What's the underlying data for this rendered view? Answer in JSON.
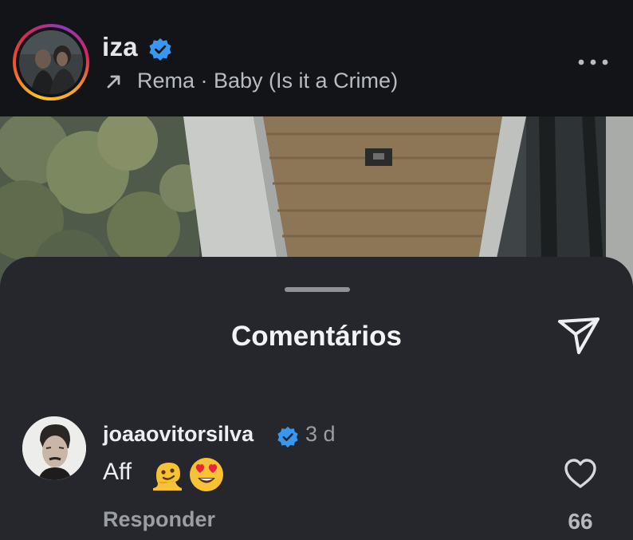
{
  "story": {
    "username": "iza",
    "verified": true,
    "music": "Rema · Baby (Is it a Crime)",
    "icons": {
      "music": "arrow-up-right-icon",
      "more": "more-dots-icon"
    }
  },
  "comments_sheet": {
    "title": "Comentários",
    "share_icon": "send-icon",
    "comments": [
      {
        "username": "joaaovitorsilva",
        "verified": true,
        "time": "3 d",
        "text": "Aff",
        "emojis": [
          "melting-face",
          "smiling-face-with-heart-eyes"
        ],
        "reply_label": "Responder",
        "likes": "66"
      }
    ]
  },
  "colors": {
    "background": "#121316",
    "sheet": "#25272c",
    "verified_blue": "#3897f0",
    "text_primary": "#eceef1",
    "text_secondary": "#9a9ea4"
  }
}
